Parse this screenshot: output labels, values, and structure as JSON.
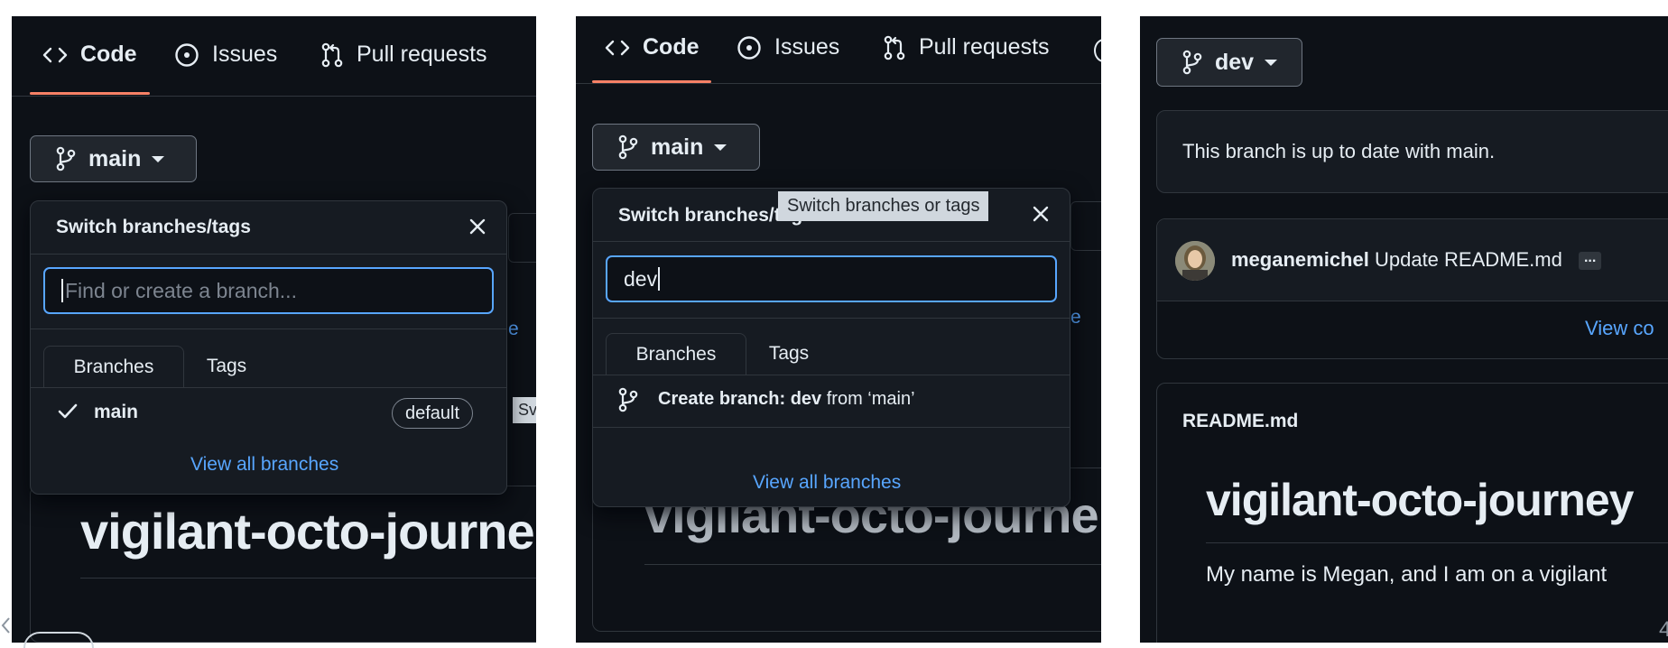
{
  "repo_tabs": {
    "code": "Code",
    "issues": "Issues",
    "pull_requests": "Pull requests"
  },
  "panel1": {
    "branch_button": "main",
    "dropdown": {
      "title": "Switch branches/tags",
      "search_placeholder": "Find or create a branch...",
      "tab_branches": "Branches",
      "tab_tags": "Tags",
      "branch_name": "main",
      "branch_badge": "default",
      "view_all": "View all branches"
    },
    "repo_title": "vigilant-octo-journe",
    "partial_tooltip": "Sv"
  },
  "panel2": {
    "branch_button": "main",
    "tooltip": "Switch branches or tags",
    "dropdown": {
      "title": "Switch branches/tags",
      "search_value": "dev",
      "tab_branches": "Branches",
      "tab_tags": "Tags",
      "create_label": "Create branch: dev",
      "create_from": "from ‘main’",
      "view_all": "View all branches"
    },
    "repo_title": "vigilant-octo-journe"
  },
  "panel3": {
    "branch_button": "dev",
    "status": "This branch is up to date with main.",
    "commit": {
      "author": "meganemichel",
      "message": "Update README.md",
      "ellipsis": "..."
    },
    "view_code": "View co",
    "readme": {
      "filename": "README.md",
      "title": "vigilant-octo-journey",
      "body": "My name is Megan, and I am on a vigilant"
    }
  },
  "edge_fragment": "4"
}
